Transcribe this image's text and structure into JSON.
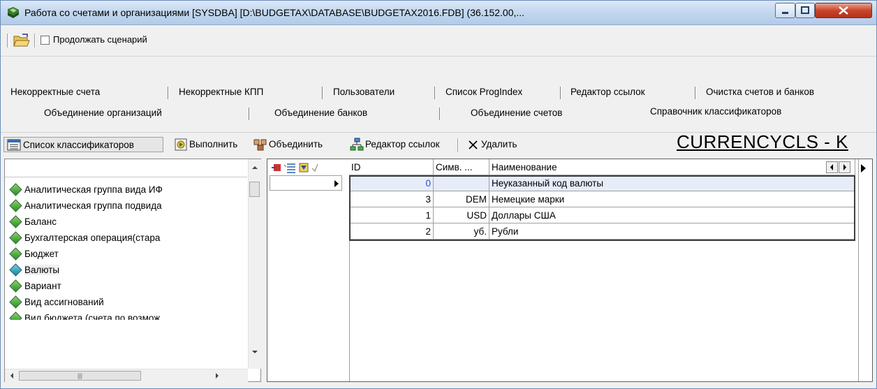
{
  "window": {
    "title": "Работа со счетами и организациями [SYSDBA] [D:\\BUDGETAX\\DATABASE\\BUDGETAX2016.FDB] (36.152.00,..."
  },
  "toolbar": {
    "continue_script_label": "Продолжать сценарий",
    "continue_script_checked": false
  },
  "tabs": {
    "row1": [
      "Некорректные счета",
      "Некорректные КПП",
      "Пользователи",
      "Список ProgIndex",
      "Редактор ссылок",
      "Очистка счетов и банков"
    ],
    "row2": [
      "Объединение организаций",
      "Объединение банков",
      "Объединение счетов",
      "Справочник классификаторов"
    ],
    "active": "Справочник классификаторов"
  },
  "actions": {
    "list_label": "Список классификаторов",
    "run_label": "Выполнить",
    "merge_label": "Объединить",
    "links_label": "Редактор ссылок",
    "delete_label": "Удалить"
  },
  "table_title": "CURRENCYCLS - K",
  "classifiers": {
    "items": [
      "Аналитическая группа вида ИФ",
      "Аналитическая группа подвида",
      "Баланс",
      "Бухгалтерская операция(стара",
      "Бюджет",
      "Валюты",
      "Вариант",
      "Вид ассигнований",
      "Вид бюджета (счета по возмож"
    ],
    "selected": "Валюты"
  },
  "grid": {
    "columns": [
      "ID",
      "Симв. ...",
      "Наименование"
    ],
    "rows": [
      {
        "id": "0",
        "sym": "",
        "name": "Неуказанный код валюты"
      },
      {
        "id": "3",
        "sym": "DEM",
        "name": "Немецкие марки"
      },
      {
        "id": "1",
        "sym": "USD",
        "name": "Доллары США"
      },
      {
        "id": "2",
        "sym": "уб.",
        "name": "Рубли"
      }
    ]
  },
  "colors": {
    "titlebar": "#c2d7ef",
    "close_button": "#c7452b",
    "selected_row": "#e7ecf9"
  }
}
